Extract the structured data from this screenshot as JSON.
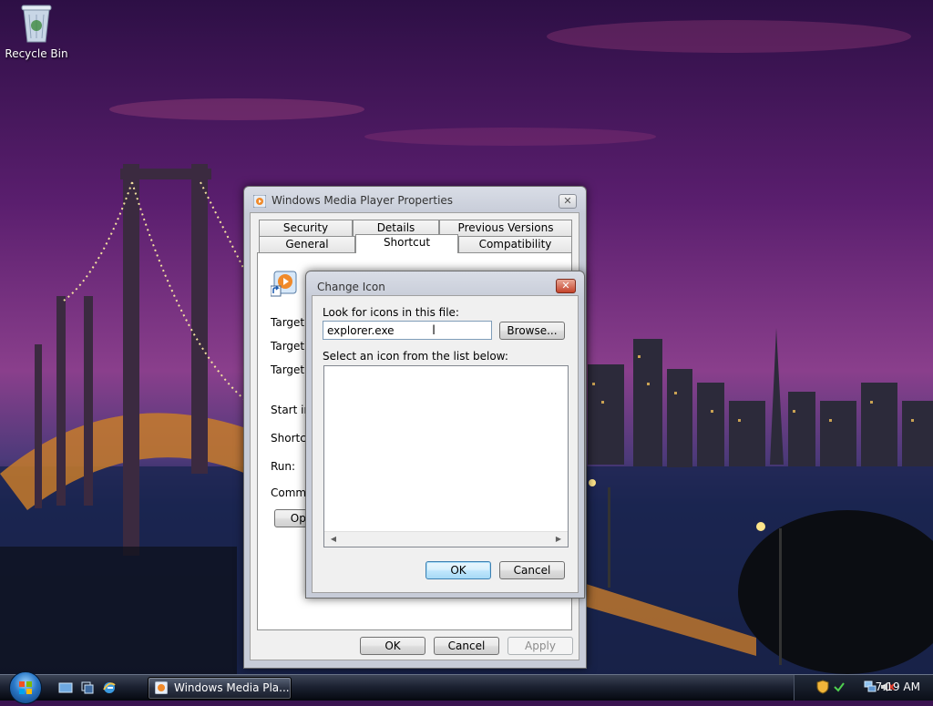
{
  "desktop": {
    "recycle_bin_label": "Recycle Bin"
  },
  "properties_window": {
    "title": "Windows Media Player Properties",
    "tabs_row1": [
      "Security",
      "Details",
      "Previous Versions"
    ],
    "tabs_row2": [
      "General",
      "Shortcut",
      "Compatibility"
    ],
    "active_tab": "Shortcut",
    "field_labels": {
      "target_type": "Target ty",
      "target_location": "Target lo",
      "target": "Target:",
      "start_in": "Start in:",
      "shortcut_key": "Shortcut",
      "run": "Run:",
      "comment": "Commen"
    },
    "open_location_button": "Ope",
    "buttons": {
      "ok": "OK",
      "cancel": "Cancel",
      "apply": "Apply"
    }
  },
  "change_icon_dialog": {
    "title": "Change Icon",
    "file_label": "Look for icons in this file:",
    "file_value": "explorer.exe",
    "browse_button": "Browse...",
    "list_label": "Select an icon from the list below:",
    "ok_button": "OK",
    "cancel_button": "Cancel"
  },
  "taskbar": {
    "task_button_label": "Windows Media Pla...",
    "clock": "7:19 AM"
  },
  "colors": {
    "accent_default_button": "#3c7fb1",
    "taskbar": "#1c2232"
  },
  "icons": [
    "recycle-bin-icon",
    "start-orb",
    "show-desktop-icon",
    "switch-windows-icon",
    "internet-explorer-icon",
    "media-player-icon",
    "shield-icon",
    "network-icon",
    "volume-muted-icon"
  ]
}
